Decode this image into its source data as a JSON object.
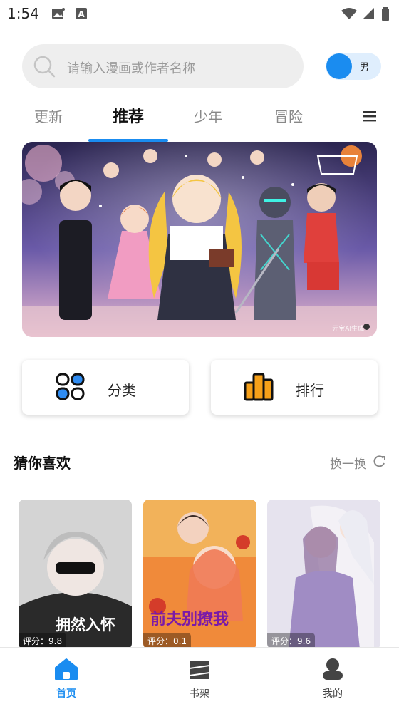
{
  "status": {
    "time": "1:54"
  },
  "search": {
    "placeholder": "请输入漫画或作者名称"
  },
  "gender_toggle": {
    "label": "男"
  },
  "tabs": [
    {
      "label": "更新",
      "active": false
    },
    {
      "label": "推荐",
      "active": true
    },
    {
      "label": "少年",
      "active": false
    },
    {
      "label": "冒险",
      "active": false
    }
  ],
  "banner": {
    "watermark": "元宝AI生成"
  },
  "quick_links": {
    "category": "分类",
    "ranking": "排行"
  },
  "recommend": {
    "title": "猜你喜欢",
    "refresh": "换一换",
    "items": [
      {
        "cover_title": "拥然入怀",
        "score": "评分：9.8"
      },
      {
        "cover_title": "前夫别撩我",
        "score": "评分：0.1"
      },
      {
        "cover_title": "",
        "score": "评分：9.6"
      }
    ]
  },
  "bottom_nav": {
    "home": "首页",
    "shelf": "书架",
    "mine": "我的"
  },
  "colors": {
    "accent": "#1a8cf0"
  },
  "icons": [
    "search-icon",
    "menu-icon",
    "category-icon",
    "ranking-icon",
    "refresh-icon",
    "home-icon",
    "bookshelf-icon",
    "user-icon"
  ]
}
